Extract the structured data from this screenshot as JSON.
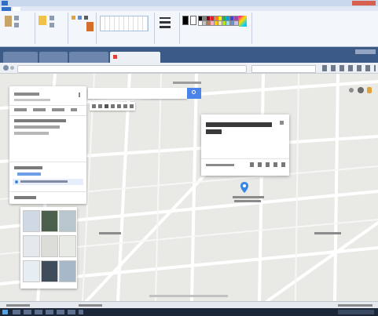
{
  "colors": {
    "paint_chrome": "#c9d7ea",
    "browser_tabbar": "#3c5a86",
    "map_background": "#e9e9e6",
    "map_road": "#ffffff",
    "search_button": "#4a84e8",
    "map_pin": "#3a86e6",
    "taskbar": "#1b2638"
  },
  "paint": {
    "palette": [
      "#000000",
      "#7f7f7f",
      "#880015",
      "#ed1c24",
      "#ff7f27",
      "#fff200",
      "#22b14c",
      "#00a2e8",
      "#3f48cc",
      "#a349a4",
      "#ffffff",
      "#c3c3c3",
      "#b97a57",
      "#ffaec9",
      "#ffc90e",
      "#efe4b0",
      "#b5e61d",
      "#99d9ea",
      "#7092be",
      "#c8bfe7"
    ]
  },
  "icons": {
    "browser_back": "back-arrow-icon",
    "search": "search-icon",
    "pin": "map-pin-icon",
    "start": "windows-start-icon"
  }
}
